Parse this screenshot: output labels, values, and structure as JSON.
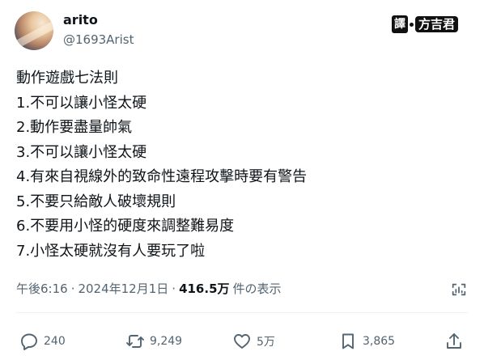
{
  "post": {
    "author": {
      "display_name": "arito",
      "handle": "@1693Arist"
    },
    "watermark": {
      "tag": "譯",
      "name": "方吉君"
    },
    "lines": [
      "動作遊戲七法則",
      "1.不可以讓小怪太硬",
      "2.動作要盡量帥氣",
      "3.不可以讓小怪太硬",
      "4.有來自視線外的致命性遠程攻擊時要有警告",
      "5.不要只給敵人破壞規則",
      "6.不要用小怪的硬度來調整難易度",
      "7.小怪太硬就沒有人要玩了啦"
    ],
    "meta": {
      "time": "午後6:16",
      "separator": "·",
      "date": "2024年12月1日",
      "views": "416.5万",
      "views_suffix": "件の表示"
    },
    "stats": {
      "replies": "240",
      "reposts": "9,249",
      "likes": "5万",
      "bookmarks": "3,865"
    }
  },
  "icons": {
    "analytics": "analytics-icon",
    "reply": "reply-icon",
    "repost": "repost-icon",
    "like": "heart-icon",
    "bookmark": "bookmark-icon",
    "share": "share-icon"
  }
}
